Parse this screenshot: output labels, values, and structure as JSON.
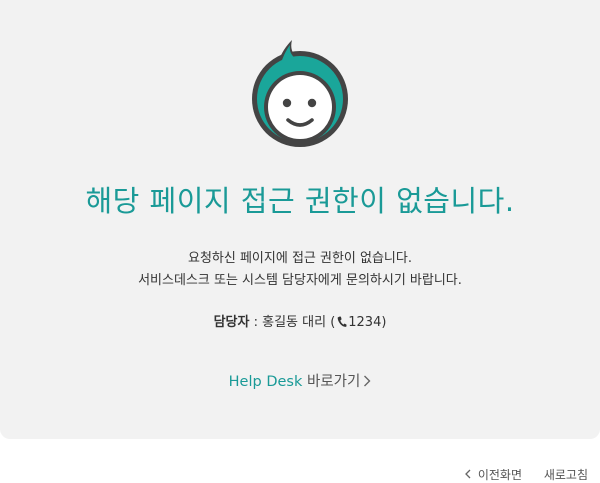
{
  "colors": {
    "accent": "#1a9a97",
    "panel": "#f2f2f2",
    "mascot_outline": "#444444"
  },
  "main": {
    "headline": "해당 페이지 접근 권한이 없습니다.",
    "desc_line1": "요청하신 페이지에 접근 권한이 없습니다.",
    "desc_line2": "서비스데스크 또는 시스템 담당자에게 문의하시기 바랍니다."
  },
  "contact": {
    "label": "담당자",
    "separator": " : ",
    "name": "홍길동 대리 (",
    "phone_icon": "phone-icon",
    "extension": "1234)"
  },
  "helpdesk": {
    "name": "Help Desk",
    "action": " 바로가기"
  },
  "footer": {
    "back_label": "이전화면",
    "refresh_label": "새로고침"
  }
}
